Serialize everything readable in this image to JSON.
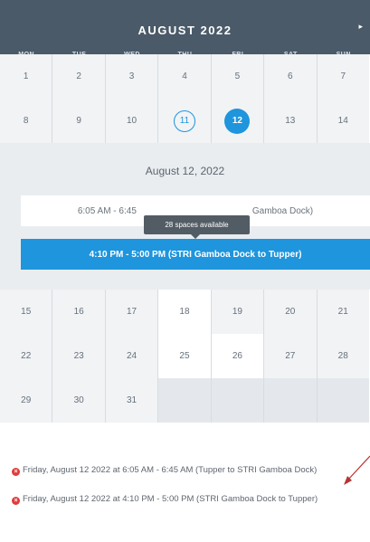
{
  "calendar": {
    "month_title": "AUGUST 2022",
    "next_icon": "chevron-right-icon",
    "weekdays": [
      "MON",
      "TUE",
      "WED",
      "THU",
      "FRI",
      "SAT",
      "SUN"
    ],
    "weeks": [
      [
        "1",
        "2",
        "3",
        "4",
        "5",
        "6",
        "7"
      ],
      [
        "8",
        "9",
        "10",
        "11",
        "12",
        "13",
        "14"
      ],
      [
        "15",
        "16",
        "17",
        "18",
        "19",
        "20",
        "21"
      ],
      [
        "22",
        "23",
        "24",
        "25",
        "26",
        "27",
        "28"
      ],
      [
        "29",
        "30",
        "31",
        "",
        "",
        "",
        ""
      ]
    ],
    "today": "11",
    "selected": "12",
    "selected_color": "#1e95dc"
  },
  "detail": {
    "date": "August 12, 2022",
    "slot_1": "6:05 AM - 6:45 AM (Tupper to STRI Gamboa Dock)",
    "slot_1_left": "6:05 AM - 6:45",
    "slot_1_right": "Gamboa Dock)",
    "slot_2": "4:10 PM - 5:00 PM (STRI Gamboa Dock to Tupper)",
    "tooltip": "28 spaces available"
  },
  "selections": [
    {
      "text": "Friday, August 12 2022 at 6:05 AM - 6:45 AM (Tupper to STRI Gamboa Dock)",
      "icon": "remove-icon"
    },
    {
      "text": "Friday, August 12 2022 at 4:10 PM - 5:00 PM (STRI Gamboa Dock to Tupper)",
      "icon": "remove-icon"
    }
  ],
  "colors": {
    "header_bg": "#4a5a68",
    "accent": "#1e95dc",
    "remove": "#e23b3b",
    "annotation_arrow": "#b83232"
  }
}
